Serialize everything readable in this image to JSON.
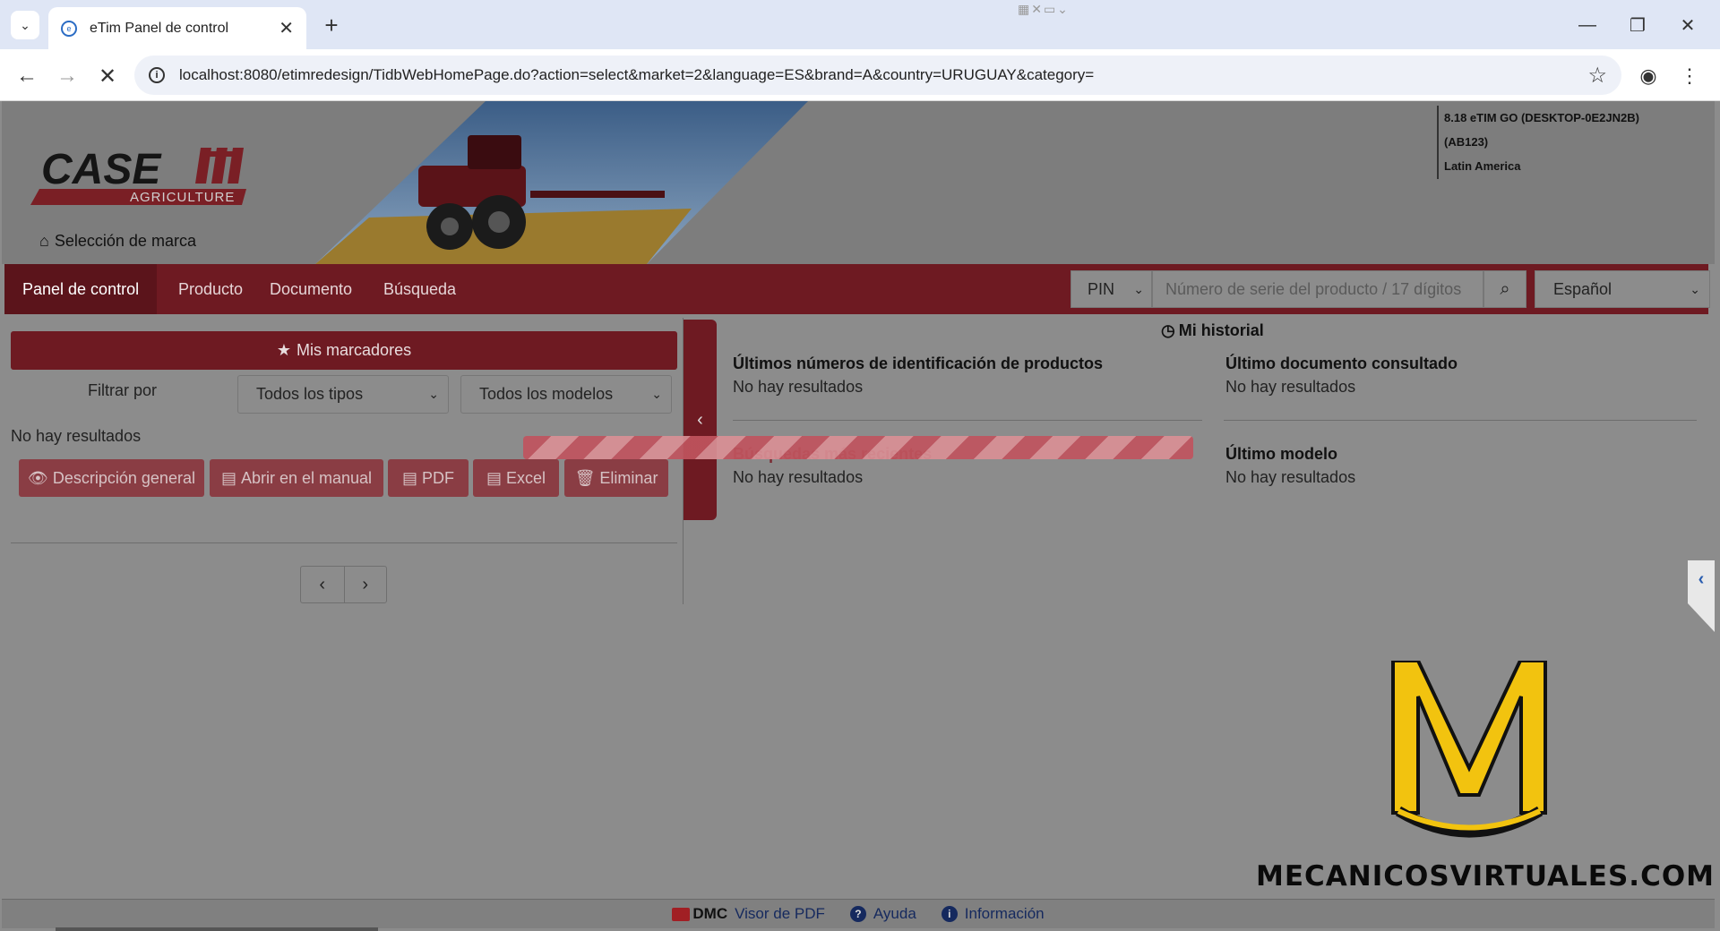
{
  "browser": {
    "tab_title": "eTim Panel de control",
    "url": "localhost:8080/etimredesign/TidbWebHomePage.do?action=select&market=2&language=ES&brand=A&country=URUGUAY&category="
  },
  "header": {
    "logo_text": "CASE",
    "logo_sub": "AGRICULTURE",
    "brand_link": "Selección de marca",
    "version": "8.18 eTIM GO (DESKTOP-0E2JN2B)",
    "dealer": "(AB123)",
    "region": "Latin America"
  },
  "nav": {
    "items": [
      "Panel de control",
      "Producto",
      "Documento",
      "Búsqueda"
    ],
    "pin_label": "PIN",
    "pin_placeholder": "Número de serie del producto / 17 dígitos",
    "language": "Español"
  },
  "bookmarks": {
    "title": "Mis marcadores",
    "filter_label": "Filtrar por",
    "type_select": "Todos los tipos",
    "model_select": "Todos los modelos",
    "empty": "No hay resultados",
    "actions": [
      "Descripción general",
      "Abrir en el manual",
      "PDF",
      "Excel",
      "Eliminar"
    ]
  },
  "history": {
    "title": "Mi historial",
    "sections": [
      {
        "title": "Últimos números de identificación de productos",
        "value": "No hay resultados"
      },
      {
        "title": "Último documento consultado",
        "value": "No hay resultados"
      },
      {
        "title": "Búsquedas más recientes",
        "value": "No hay resultados"
      },
      {
        "title": "Último modelo",
        "value": "No hay resultados"
      }
    ]
  },
  "watermark": "MECANICOSVIRTUALES.COM",
  "footer": {
    "dmc": "DMC",
    "pdf_viewer": "Visor de PDF",
    "help": "Ayuda",
    "info": "Información"
  },
  "colors": {
    "brand_red": "#6e1a22",
    "overlay_gray": "#8c8c8c",
    "footer_link": "#15295e"
  }
}
